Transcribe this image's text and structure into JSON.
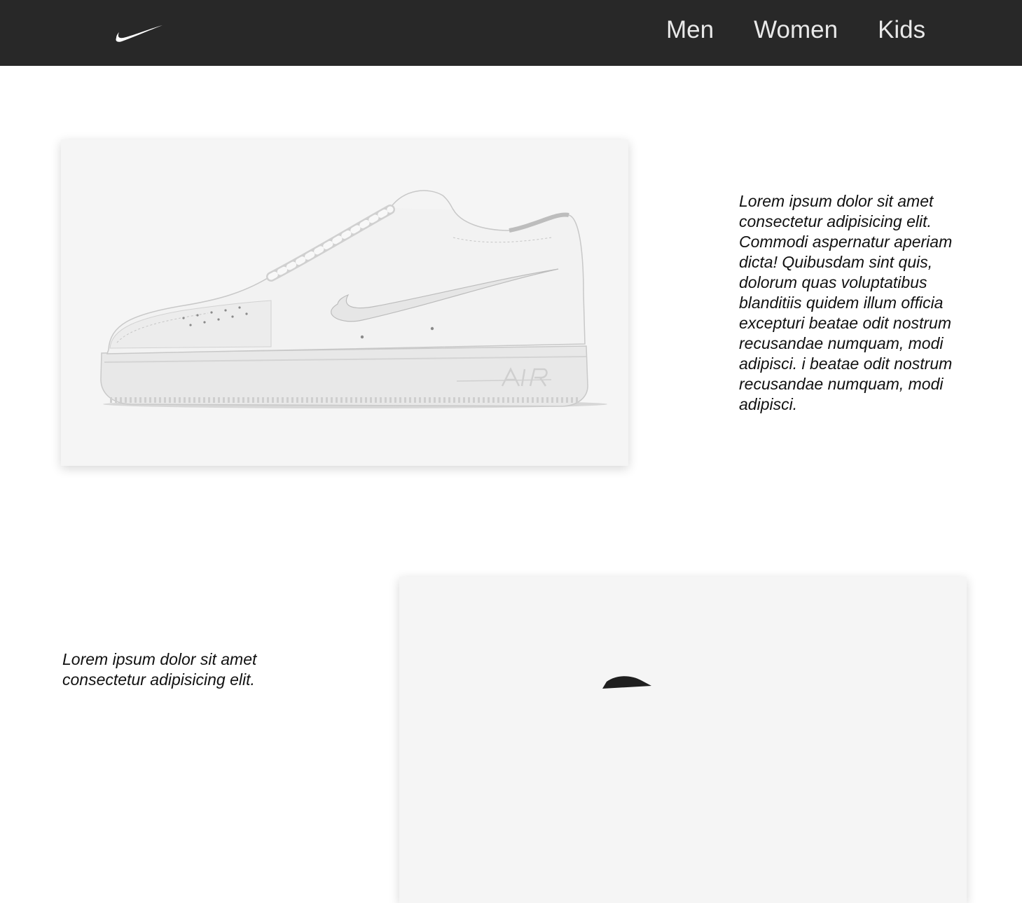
{
  "header": {
    "logo_icon": "swoosh-logo-icon",
    "nav": [
      {
        "label": "Men"
      },
      {
        "label": "Women"
      },
      {
        "label": "Kids"
      }
    ]
  },
  "products": [
    {
      "image_icon": "white-sneaker-image",
      "description": "Lorem ipsum dolor sit amet consectetur adipisicing elit. Commodi aspernatur aperiam dicta! Quibusdam sint quis, dolorum quas voluptatibus blanditiis quidem illum officia excepturi beatae odit nostrum recusandae numquam, modi adipisci. i beatae odit nostrum recusandae numquam, modi adipisci."
    },
    {
      "image_icon": "black-sneaker-image",
      "description": "Lorem ipsum dolor sit amet consectetur adipisicing elit."
    }
  ],
  "colors": {
    "navbar": "#282828",
    "nav_text": "#e9e9e9",
    "card_bg": "#f5f5f5",
    "text": "#111111"
  }
}
